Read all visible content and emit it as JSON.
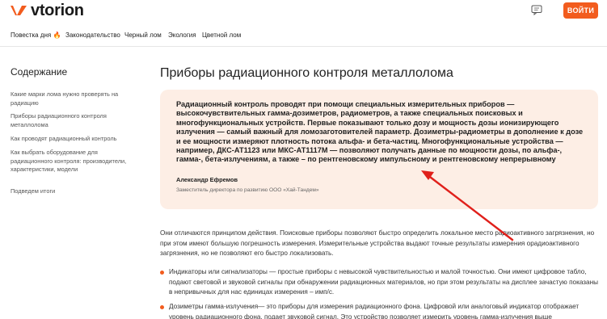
{
  "header": {
    "logo_text": "vtorion",
    "login_label": "ВОЙТИ",
    "brand_color": "#f25c1e",
    "chat_icon": "chat-icon"
  },
  "nav": {
    "items": [
      {
        "label": "Повестка дня"
      },
      {
        "label": "Законодательство"
      },
      {
        "label": "Черный лом"
      },
      {
        "label": "Экология"
      },
      {
        "label": "Цветной лом"
      }
    ],
    "hot_icon": "🔥"
  },
  "toc": {
    "title": "Содержание",
    "items": [
      {
        "label": "Какие марки лома нужно проверять на радиацию"
      },
      {
        "label": "Приборы радиационного контроля металлолома"
      },
      {
        "label": "Как проводят радиационный контроль"
      },
      {
        "label": "Как выбрать оборудование для радиационного контроля: производители, характеристики, модели"
      },
      {
        "label": "Подведем итоги"
      }
    ]
  },
  "main": {
    "title": "Приборы радиационного контроля металлолома",
    "quote": {
      "text": "Радиационный контроль проводят при помощи специальных измерительных приборов — высокочувствительных гамма-дозиметров, радиометров, а также специальных поисковых и многофункциональных устройств. Первые показывают только дозу и мощность дозы ионизирующего излучения — самый важный для ломозаготовителей параметр. Дозиметры-радиометры в дополнение к дозе и ее мощности измеряют плотность потока альфа- и бета-частиц. Многофункциональные устройства — например, ДКС-АТ1123 или МКС-АТ1117М — позволяют получать данные по мощности дозы, по альфа-, гамма-, бета-излучениям, а также – по рентгеновскому импульсному и рентгеновскому непрерывному",
      "author": "Александр Ефремов",
      "role": "Заместитель директора по развитию ООО «Хай-Тандем»"
    },
    "paragraph": "Они отличаются принципом действия. Поисковые приборы позволяют быстро определить локальное место радиоактивного загрязнения, но при этом имеют большую погрешность измерения. Измерительные устройства выдают точные результаты измерения орадиоактивного загрязнения, но не позволяют его быстро локализовать.",
    "bullets": [
      {
        "text": "Индикаторы или сигнализаторы — простые приборы с невысокой чувствительностью и малой точностью. Они имеют цифровое табло, подают световой и звуковой сигналы при обнаружении радиационных материалов, но при этом результаты на дисплее зачастую показаны в непривычных для нас единицах измерения – имп/с."
      },
      {
        "text": "Дозиметры гамма-излучения— это приборы для измерения радиационного фона. Цифровой или аналоговый индикатор отображает уровень радиационного фона, подает звуковой сигнал. Это устройство позволяет измерить уровень гамма-излучения выше"
      }
    ]
  }
}
